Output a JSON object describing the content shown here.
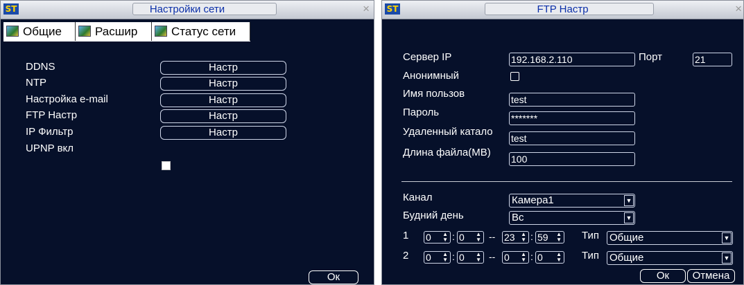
{
  "logo_text": "ST",
  "network_window": {
    "title": "Настройки сети",
    "close_glyph": "×",
    "tabs": [
      "Общие",
      "Расшир",
      "Статус сети"
    ],
    "rows": [
      {
        "label": "DDNS",
        "button": "Настр"
      },
      {
        "label": "NTP",
        "button": "Настр"
      },
      {
        "label": "Настройка e-mail",
        "button": "Настр"
      },
      {
        "label": "FTP Настр",
        "button": "Настр"
      },
      {
        "label": "IP Фильтр",
        "button": "Настр"
      }
    ],
    "upnp_label": "UPNP вкл",
    "upnp_checked": false,
    "ok_label": "Ок"
  },
  "ftp_window": {
    "title": "FTP Настр",
    "close_glyph": "×",
    "server_ip_label": "Сервер IP",
    "server_ip_value": "192.168.2.110",
    "port_label": "Порт",
    "port_value": "21",
    "anonymous_label": "Анонимный",
    "anonymous_checked": false,
    "username_label": "Имя пользов",
    "username_value": "test",
    "password_label": "Пароль",
    "password_value": "*******",
    "remote_dir_label": "Удаленный катало",
    "remote_dir_value": "test",
    "file_length_label": "Длина файла(MB)",
    "file_length_value": "100",
    "channel_label": "Канал",
    "channel_value": "Камера1",
    "weekday_label": "Будний день",
    "weekday_value": "Вс",
    "schedule": [
      {
        "index": "1",
        "start_h": "0",
        "start_m": "0",
        "dash": "--",
        "end_h": "23",
        "end_m": "59",
        "type_label": "Тип",
        "type_value": "Общие"
      },
      {
        "index": "2",
        "start_h": "0",
        "start_m": "0",
        "dash": "--",
        "end_h": "0",
        "end_m": "0",
        "type_label": "Тип",
        "type_value": "Общие"
      }
    ],
    "ok_label": "Ок",
    "cancel_label": "Отмена"
  }
}
